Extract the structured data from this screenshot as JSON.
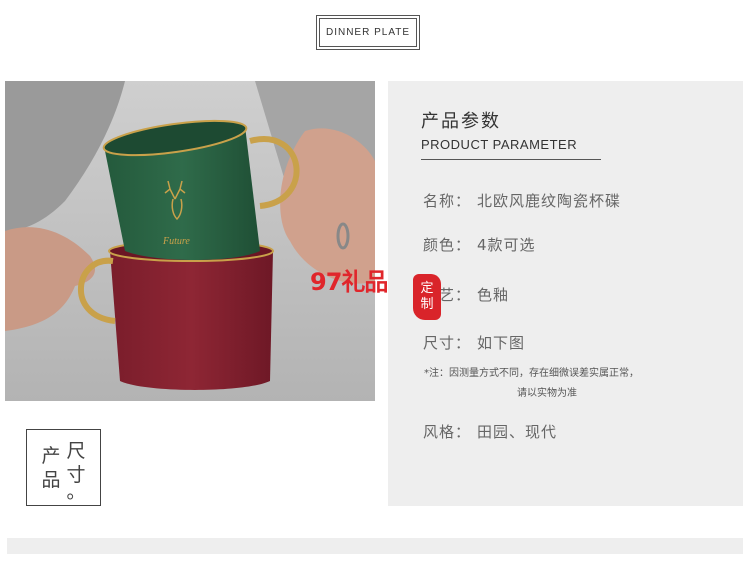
{
  "header": {
    "badge_text": "DINNER PLATE"
  },
  "panel": {
    "title": "产品参数",
    "subtitle": "PRODUCT PARAMETER",
    "params": [
      {
        "label": "名称：",
        "value": "北欧风鹿纹陶瓷杯碟"
      },
      {
        "label": "颜色：",
        "value": "4款可选"
      },
      {
        "label": "工艺：",
        "value": "色釉"
      },
      {
        "label": "尺寸：",
        "value": "如下图"
      },
      {
        "label": "风格：",
        "value": "田园、现代"
      }
    ],
    "note_line1": "*注：因测量方式不同，存在细微误差实属正常，",
    "note_line2": "请以实物为准"
  },
  "photo": {
    "mug_brand": "Future"
  },
  "watermark": {
    "text": "97礼品",
    "seal_char1": "定",
    "seal_char2": "制"
  },
  "size_box": {
    "col1_char1": "产",
    "col1_char2": "品",
    "col2_char1": "尺",
    "col2_char2": "寸",
    "col2_char3": "。"
  },
  "colors": {
    "green_mug": "#2f6b4a",
    "red_mug": "#8e2634",
    "gold": "#c9a14a",
    "stamp_red": "#e0262b"
  }
}
